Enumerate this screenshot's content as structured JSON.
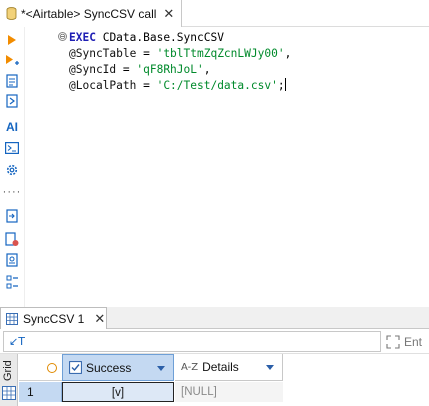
{
  "editor_tab": {
    "title": "*<Airtable> SyncCSV call",
    "close": "✕"
  },
  "toolbar": {
    "ai_label": "AI",
    "more_label": "····"
  },
  "code": {
    "fold_symbol": "⊖",
    "line1": {
      "keyword": "EXEC",
      "object": "CData.Base.SyncCSV"
    },
    "line2": {
      "param": "@SyncTable",
      "op": " = ",
      "value": "'tblTtmZqZcnLWJy00'",
      "tail": ","
    },
    "line3": {
      "param": "@SyncId",
      "op": " = ",
      "value": "'qF8RhJoL'",
      "tail": ","
    },
    "line4": {
      "param": "@LocalPath",
      "op": " = ",
      "value": "'C:/Test/data.csv'",
      "tail": ";"
    }
  },
  "results": {
    "tab_label": "SyncCSV 1",
    "tab_close": "✕",
    "filter_icon": "↙T",
    "filter_right_label": "Ent",
    "side_tab_label": "Grid",
    "columns": [
      {
        "name": "Success",
        "type_icon": "checkbox-icon"
      },
      {
        "name": "Details",
        "type_icon": "A-Z"
      }
    ],
    "rows": [
      {
        "num": "1",
        "success": "[v]",
        "details": "[NULL]"
      }
    ]
  },
  "colors": {
    "keyword": "#1f1fb4",
    "string": "#008a2b",
    "selection": "#c4d9f2",
    "accent": "#1565c0"
  }
}
